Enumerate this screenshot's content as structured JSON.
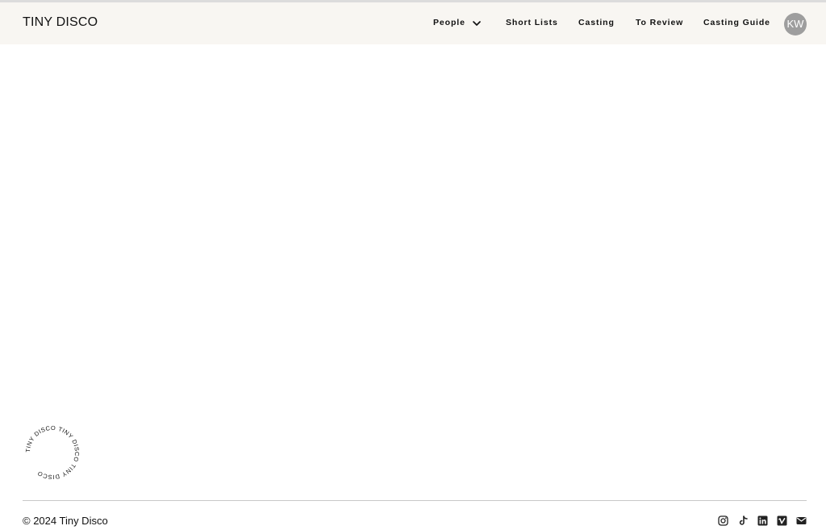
{
  "header": {
    "logo": "TINY DISCO",
    "nav": [
      {
        "label": "People",
        "has_dropdown": true
      },
      {
        "label": "Short Lists"
      },
      {
        "label": "Casting"
      },
      {
        "label": "To Review"
      },
      {
        "label": "Casting Guide"
      }
    ],
    "avatar_initials": "KW"
  },
  "badge": {
    "ring_text": "TINY DISCO TINY DISCO TINY DISCO"
  },
  "footer": {
    "copyright": "© 2024 Tiny Disco",
    "social_icons": [
      "instagram-icon",
      "tiktok-icon",
      "linkedin-icon",
      "vimeo-icon",
      "email-icon"
    ]
  },
  "colors": {
    "header_bg": "#f8f6f2",
    "text": "#111111",
    "avatar_bg": "#9e9e9e",
    "divider": "#c8c8c8"
  }
}
